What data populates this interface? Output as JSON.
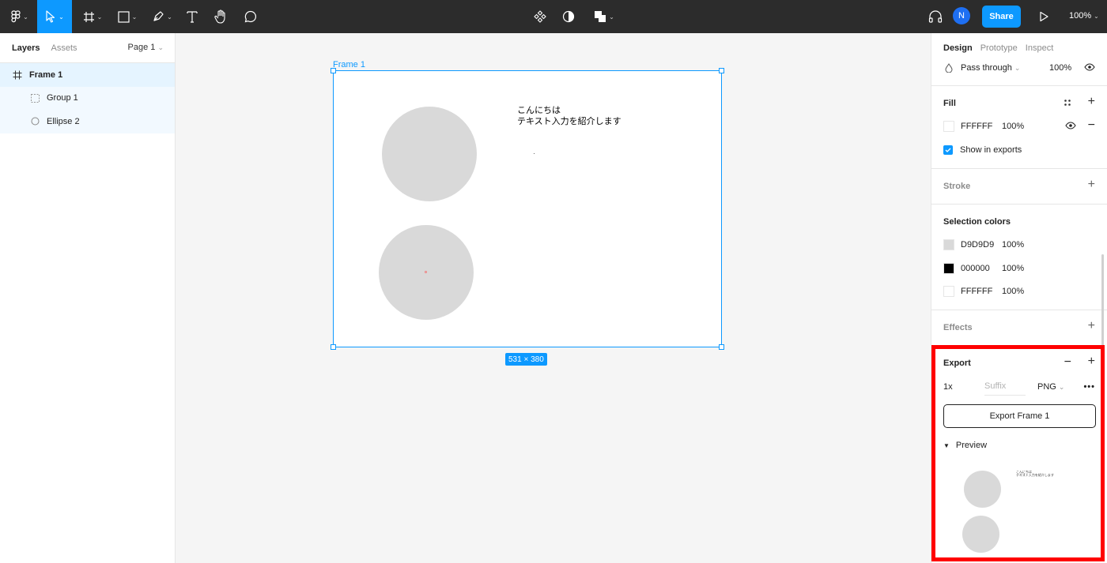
{
  "toolbar": {
    "share_label": "Share",
    "avatar_initial": "N",
    "zoom": "100%"
  },
  "left_panel": {
    "tabs": [
      "Layers",
      "Assets"
    ],
    "page": "Page 1",
    "layers": [
      {
        "name": "Frame 1",
        "icon": "frame-icon",
        "selected": true
      },
      {
        "name": "Group 1",
        "icon": "group-icon"
      },
      {
        "name": "Ellipse 2",
        "icon": "ellipse-icon"
      }
    ]
  },
  "canvas": {
    "frame_label": "Frame 1",
    "text_line1": "こんにちは",
    "text_line2": "テキスト入力を紹介します",
    "dimensions": "531 × 380",
    "fill_color": "#D9D9D9"
  },
  "right_panel": {
    "tabs": [
      "Design",
      "Prototype",
      "Inspect"
    ],
    "layer": {
      "blend": "Pass through",
      "opacity": "100%"
    },
    "fill": {
      "title": "Fill",
      "color": "FFFFFF",
      "opacity": "100%",
      "show_in_exports": "Show in exports"
    },
    "stroke": {
      "title": "Stroke"
    },
    "selection_colors": {
      "title": "Selection colors",
      "items": [
        {
          "hex": "D9D9D9",
          "opacity": "100%",
          "swatch": "#D9D9D9"
        },
        {
          "hex": "000000",
          "opacity": "100%",
          "swatch": "#000000"
        },
        {
          "hex": "FFFFFF",
          "opacity": "100%",
          "swatch": "#FFFFFF"
        }
      ]
    },
    "effects": {
      "title": "Effects"
    },
    "export": {
      "title": "Export",
      "scale": "1x",
      "suffix_placeholder": "Suffix",
      "format": "PNG",
      "button_label": "Export Frame 1",
      "preview_label": "Preview",
      "preview_text_line1": "こんにちは",
      "preview_text_line2": "テキスト入力を紹介します"
    }
  },
  "colors": {
    "accent": "#0d99ff",
    "highlight": "#ff0000",
    "toolbar": "#2c2c2c"
  }
}
